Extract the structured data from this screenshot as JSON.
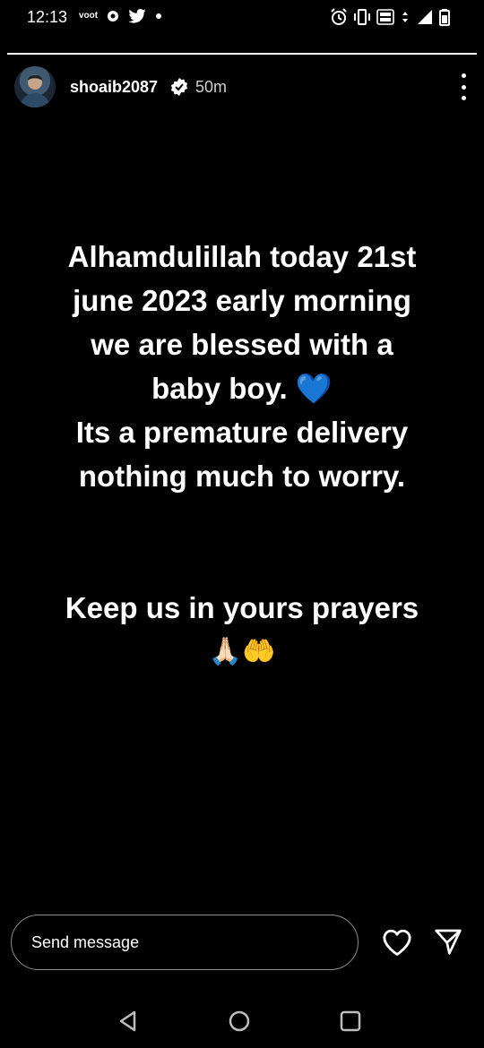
{
  "status_bar": {
    "time": "12:13",
    "left_icons": [
      "voot-icon",
      "app-icon",
      "twitter-icon",
      "dot-icon"
    ],
    "voot_label": "voot",
    "right_icons": [
      "alarm-icon",
      "vibrate-icon",
      "volte-icon",
      "data-4g-icon",
      "signal-icon",
      "battery-icon"
    ]
  },
  "story": {
    "progress": 1.0,
    "username": "shoaib2087",
    "verified": true,
    "time_ago": "50m",
    "text_lines": [
      "Alhamdulillah today 21st",
      "june 2023 early morning",
      "we are blessed with a",
      "baby boy. 💙",
      "Its a premature delivery",
      "nothing much to worry."
    ],
    "closing_line": "Keep us in yours prayers",
    "closing_emoji": "🙏🏻🤲"
  },
  "reply": {
    "placeholder": "Send message"
  },
  "colors": {
    "background": "#000000",
    "text": "#ffffff",
    "input_border": "#8e8e8e",
    "verified_badge": "#ffffff"
  }
}
